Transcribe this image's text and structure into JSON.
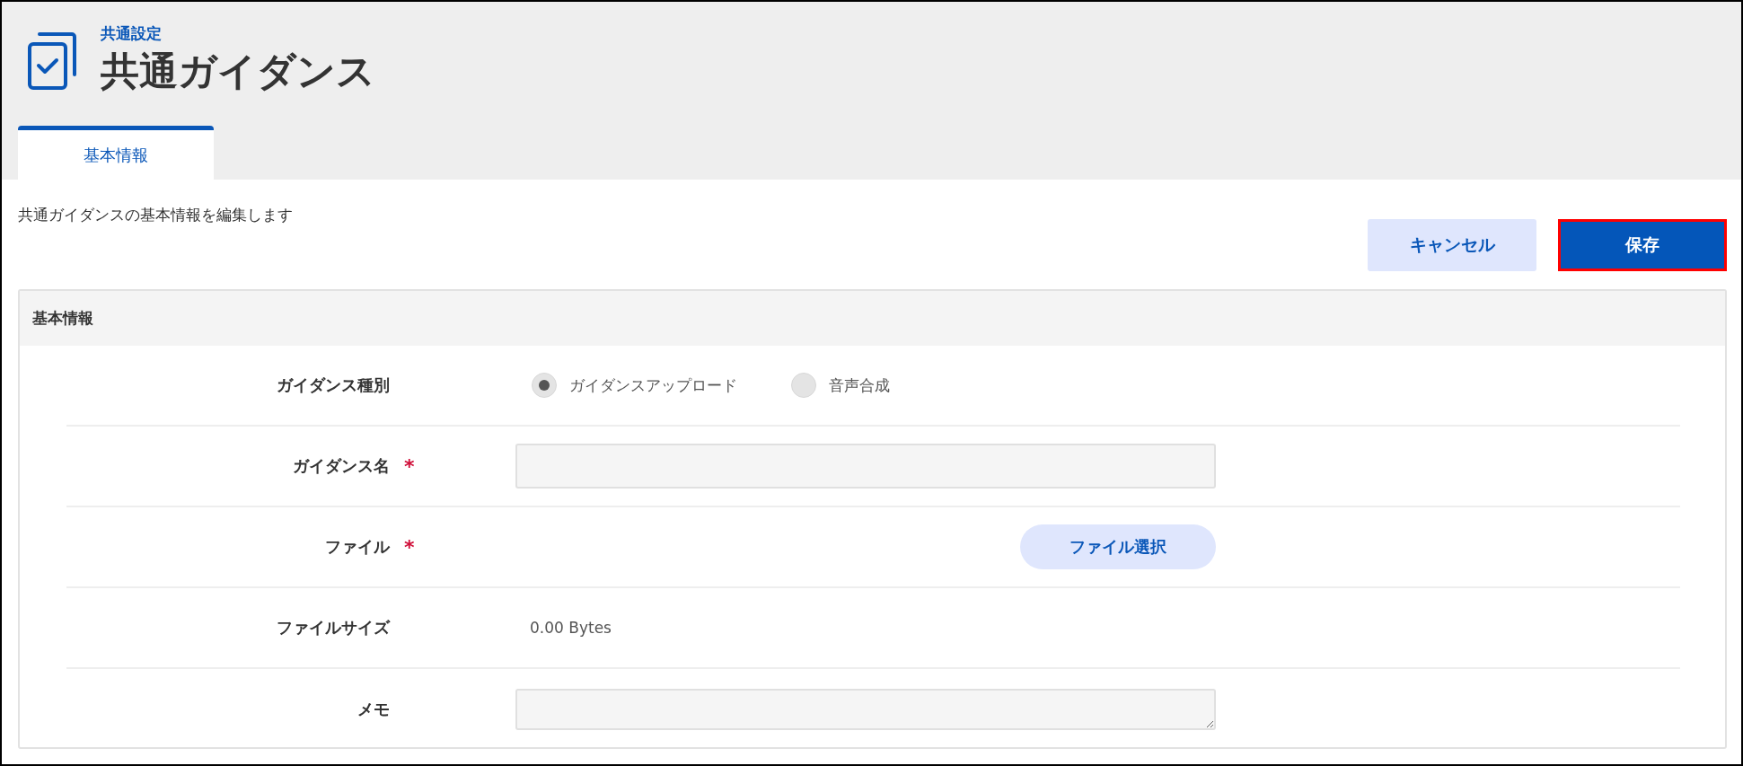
{
  "header": {
    "breadcrumb": "共通設定",
    "title": "共通ガイダンス"
  },
  "tabs": [
    {
      "label": "基本情報",
      "selected": true
    }
  ],
  "description": "共通ガイダンスの基本情報を編集します",
  "buttons": [
    {
      "label": "キャンセル",
      "kind": "secondary"
    },
    {
      "label": "保存",
      "kind": "primary"
    }
  ],
  "panel": {
    "title": "基本情報",
    "fields": [
      {
        "kind": "radio",
        "label": "ガイダンス種別",
        "options": [
          {
            "label": "ガイダンスアップロード",
            "selected": true
          },
          {
            "label": "音声合成",
            "selected": false
          }
        ]
      },
      {
        "kind": "text",
        "label": "ガイダンス名",
        "required_mark": "*"
      },
      {
        "kind": "file",
        "label": "ファイル",
        "required_mark": "*",
        "button": "ファイル選択"
      },
      {
        "kind": "static",
        "label": "ファイルサイズ",
        "value": "0.00 Bytes"
      },
      {
        "kind": "textarea",
        "label": "メモ"
      }
    ]
  }
}
